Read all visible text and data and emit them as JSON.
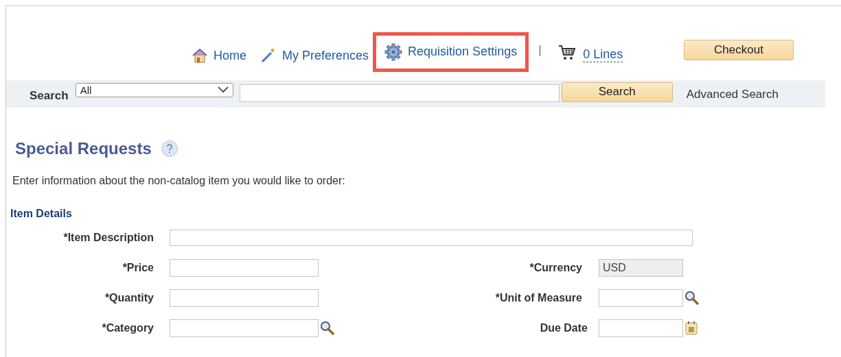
{
  "nav": [
    {
      "kind": "home",
      "label": "Home",
      "highlighted": false
    },
    {
      "kind": "preferences",
      "label": "My Preferences",
      "highlighted": false
    },
    {
      "kind": "settings",
      "label": "Requisition Settings",
      "highlighted": true
    }
  ],
  "cart": {
    "label": "0 Lines"
  },
  "checkout_button": "Checkout",
  "search": {
    "label": "Search",
    "scope": "All",
    "button": "Search",
    "advanced_link": "Advanced Search"
  },
  "page_title": "Special Requests",
  "instructions": "Enter information about the non-catalog item you would like to order:",
  "section_title": "Item Details",
  "item_description": {
    "label": "*Item Description"
  },
  "rows": [
    {
      "left": {
        "label": "*Price",
        "kind": "text"
      },
      "right": {
        "label": "*Currency",
        "kind": "text",
        "value": "USD",
        "disabled": true
      }
    },
    {
      "left": {
        "label": "*Quantity",
        "kind": "text"
      },
      "right": {
        "label": "*Unit of Measure",
        "kind": "lookup",
        "disabled": false
      }
    },
    {
      "left": {
        "label": "*Category",
        "kind": "lookup"
      },
      "right": {
        "label": "Due Date",
        "kind": "date",
        "disabled": false
      }
    }
  ]
}
